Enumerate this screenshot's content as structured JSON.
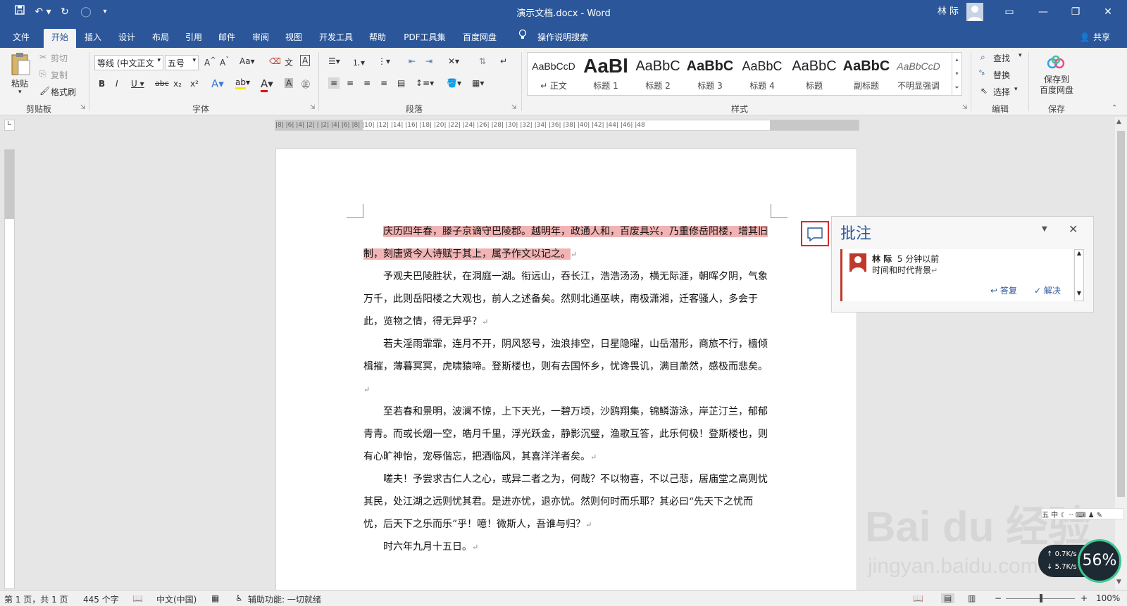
{
  "window": {
    "title": "演示文档.docx  -  Word",
    "user": "林 际"
  },
  "menu": {
    "tabs": [
      "文件",
      "开始",
      "插入",
      "设计",
      "布局",
      "引用",
      "邮件",
      "审阅",
      "视图",
      "开发工具",
      "帮助",
      "PDF工具集",
      "百度网盘"
    ],
    "active": "开始",
    "tellme": "操作说明搜索",
    "share": "共享"
  },
  "ribbon": {
    "clipboard": {
      "paste": "粘贴",
      "cut": "剪切",
      "copy": "复制",
      "format_painter": "格式刷",
      "label": "剪贴板"
    },
    "font": {
      "name": "等线 (中文正文",
      "size": "五号",
      "label": "字体"
    },
    "paragraph": {
      "label": "段落"
    },
    "styles": {
      "label": "样式",
      "items": [
        {
          "preview": "AaBbCcD",
          "name": "↵ 正文"
        },
        {
          "preview": "AaBl",
          "name": "标题 1"
        },
        {
          "preview": "AaBbC",
          "name": "标题 2"
        },
        {
          "preview": "AaBbC",
          "name": "标题 3"
        },
        {
          "preview": "AaBbC",
          "name": "标题 4"
        },
        {
          "preview": "AaBbC",
          "name": "标题"
        },
        {
          "preview": "AaBbC",
          "name": "副标题"
        },
        {
          "preview": "AaBbCcD",
          "name": "不明显强调"
        }
      ]
    },
    "editing": {
      "find": "查找",
      "replace": "替换",
      "select": "选择",
      "label": "编辑"
    },
    "save": {
      "button": "保存到\n百度网盘",
      "label": "保存"
    }
  },
  "ruler": {
    "marks": "|8|  |6|  |4|  |2|  |  |2|  |4|  |6|  |8|  |10|  |12|  |14|  |16|  |18|  |20|  |22|  |24|  |26|  |28|  |30|  |32|  |34|  |36|  |38|  |40|  |42|  |44|  |46|  |48"
  },
  "document": {
    "paragraphs": [
      {
        "text": "庆历四年春，滕子京谪守巴陵郡。越明年，政通人和，百废具兴，乃重修岳阳楼，增其旧制，刻唐贤今人诗赋于其上，属予作文以记之。",
        "highlight": true
      },
      {
        "text": "予观夫巴陵胜状，在洞庭一湖。衔远山，吞长江，浩浩汤汤，横无际涯，朝晖夕阴，气象万千，此则岳阳楼之大观也，前人之述备矣。然则北通巫峡，南极潇湘，迁客骚人，多会于此，览物之情，得无异乎？"
      },
      {
        "text": "若夫淫雨霏霏，连月不开，阴风怒号，浊浪排空，日星隐曜，山岳潜形，商旅不行，樯倾楫摧，薄暮冥冥，虎啸猿啼。登斯楼也，则有去国怀乡，忧谗畏讥，满目萧然，感极而悲矣。"
      },
      {
        "text": "至若春和景明，波澜不惊，上下天光，一碧万顷，沙鸥翔集，锦鳞游泳，岸芷汀兰，郁郁青青。而或长烟一空，皓月千里，浮光跃金，静影沉璧，渔歌互答，此乐何极！登斯楼也，则有心旷神怡，宠辱偕忘，把酒临风，其喜洋洋者矣。"
      },
      {
        "text": "嗟夫！予尝求古仁人之心，或异二者之为，何哉？不以物喜，不以己悲，居庙堂之高则忧其民，处江湖之远则忧其君。是进亦忧，退亦忧。然则何时而乐耶？其必曰“先天下之忧而忧，后天下之乐而乐”乎！噫！微斯人，吾谁与归？"
      },
      {
        "text": "时六年九月十五日。"
      }
    ],
    "para_mark": "↵"
  },
  "comments_pane": {
    "title": "批注",
    "author": "林 际",
    "time": "5 分钟以前",
    "text": "时间和时代背景",
    "para_mark": "↵",
    "reply": "答复",
    "resolve": "解决"
  },
  "status": {
    "page": "第 1 页，共 1 页",
    "words": "445 个字",
    "lang": "中文(中国)",
    "accessibility": "辅助功能: 一切就绪",
    "zoom": "100%"
  },
  "watermark": {
    "brand": "Bai du 经验",
    "url": "jingyan.baidu.com"
  },
  "network": {
    "up": "0.7K/s",
    "down": "5.7K/s",
    "percent": "56%"
  },
  "colors": {
    "accent": "#2b579a",
    "highlight": "#f1b3b3",
    "comment_border": "#c0392b"
  }
}
